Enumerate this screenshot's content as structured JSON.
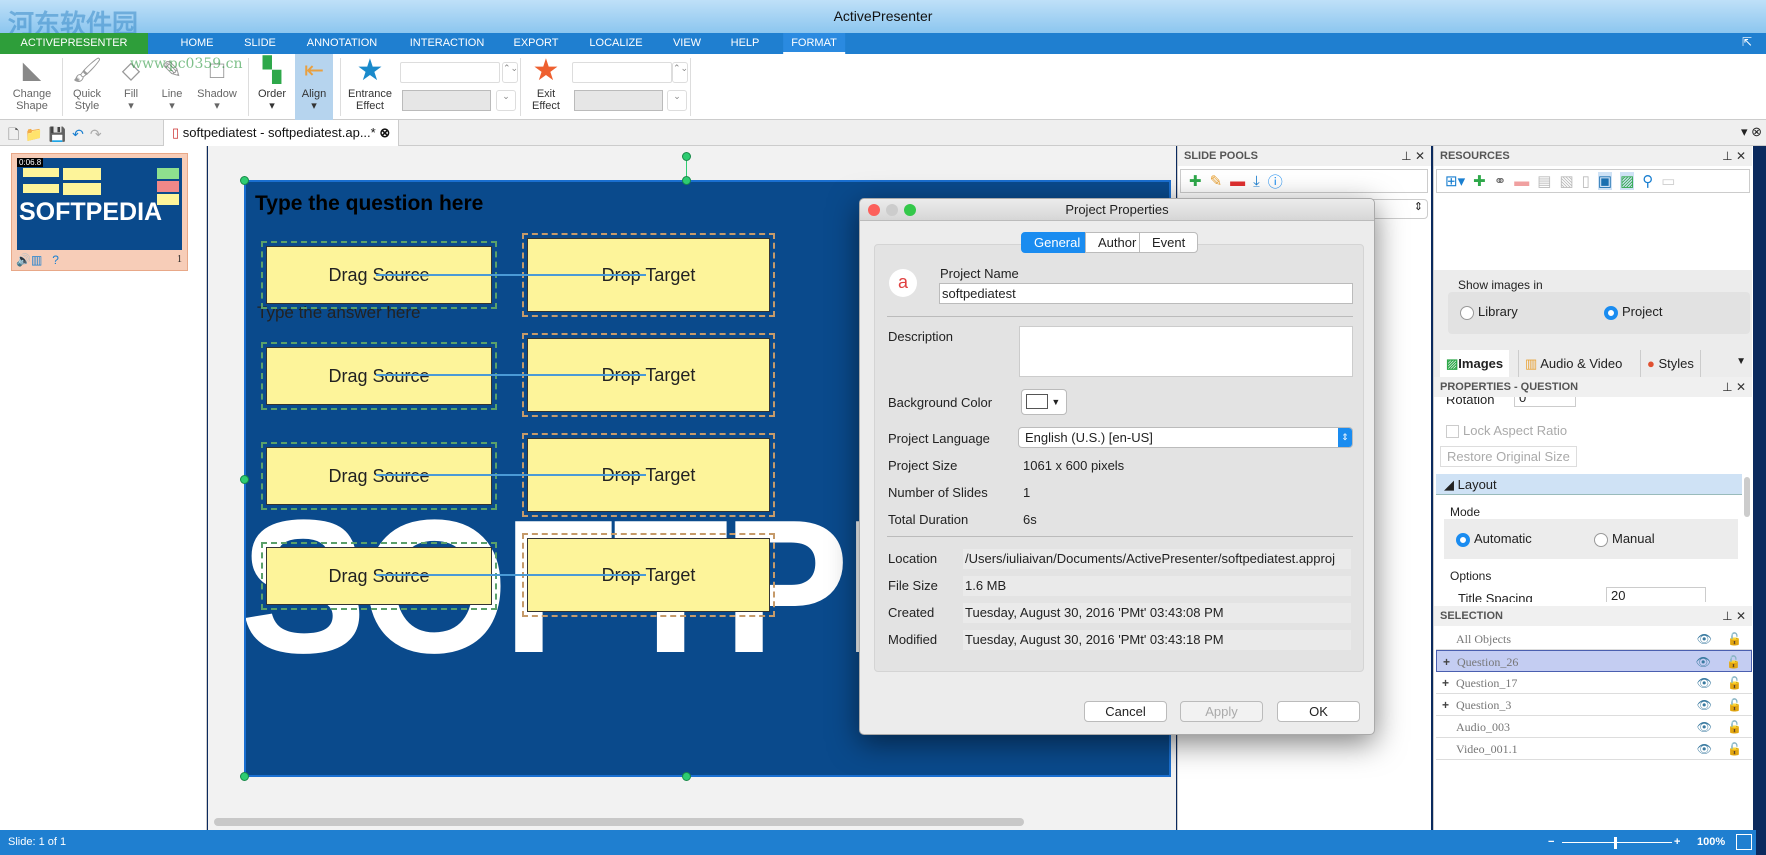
{
  "window": {
    "title": "ActivePresenter"
  },
  "watermark": {
    "text": "河东软件园",
    "url": "www.pc0359.cn"
  },
  "menu": [
    "ACTIVEPRESENTER",
    "HOME",
    "SLIDE",
    "ANNOTATION",
    "INTERACTION",
    "EXPORT",
    "LOCALIZE",
    "VIEW",
    "HELP",
    "FORMAT"
  ],
  "ribbon": {
    "change_shape": [
      "Change",
      "Shape"
    ],
    "quick_style": [
      "Quick",
      "Style"
    ],
    "fill": "Fill",
    "line": "Line",
    "shadow": "Shadow",
    "order": "Order",
    "align": "Align",
    "entrance": [
      "Entrance",
      "Effect"
    ],
    "exit": [
      "Exit",
      "Effect"
    ]
  },
  "doc_tab": {
    "label": "softpediatest - softpediatest.ap...*"
  },
  "thumbnail": {
    "time": "0:06.8",
    "number": "1",
    "logo": "SOFTPEDIA"
  },
  "slide": {
    "question": "Type the question here",
    "answer": "Type the answer here",
    "drag_sources": [
      "Drag Source",
      "Drag Source",
      "Drag Source",
      "Drag Source"
    ],
    "drop_targets": [
      "Drop Target",
      "Drop Target",
      "Drop Target",
      "Drop Target"
    ],
    "background_text": "SOFTPEDIA"
  },
  "slide_pools": {
    "title": "SLIDE POOLS"
  },
  "resources": {
    "title": "RESOURCES",
    "show_images_in": "Show images in",
    "library": "Library",
    "project": "Project",
    "tabs": [
      "Images",
      "Audio & Video",
      "Styles"
    ]
  },
  "properties": {
    "title": "PROPERTIES - QUESTION",
    "rotation": "Rotation",
    "rotation_value": "0",
    "lock_aspect": "Lock Aspect Ratio",
    "restore": "Restore Original Size",
    "layout": "Layout",
    "mode": "Mode",
    "automatic": "Automatic",
    "manual": "Manual",
    "options": "Options",
    "title_spacing": "Title Spacing",
    "title_spacing_value": "20"
  },
  "selection": {
    "title": "SELECTION",
    "items": [
      "All Objects",
      "Question_26",
      "Question_17",
      "Question_3",
      "Audio_003",
      "Video_001.1"
    ]
  },
  "status": {
    "slide": "Slide: 1 of 1",
    "zoom": "100%"
  },
  "dialog": {
    "title": "Project Properties",
    "tabs": [
      "General",
      "Author",
      "Event"
    ],
    "project_name_label": "Project Name",
    "project_name": "softpediatest",
    "description_label": "Description",
    "bg_color_label": "Background Color",
    "language_label": "Project Language",
    "language": "English (U.S.) [en-US]",
    "size_label": "Project Size",
    "size": "1061 x 600 pixels",
    "slides_label": "Number of Slides",
    "slides": "1",
    "duration_label": "Total Duration",
    "duration": "6s",
    "location_label": "Location",
    "location": "/Users/iuliaivan/Documents/ActivePresenter/softpediatest.approj",
    "filesize_label": "File Size",
    "filesize": "1.6 MB",
    "created_label": "Created",
    "created": "Tuesday, August 30, 2016 'PMt' 03:43:08 PM",
    "modified_label": "Modified",
    "modified": "Tuesday, August 30, 2016 'PMt' 03:43:18 PM",
    "cancel": "Cancel",
    "apply": "Apply",
    "ok": "OK"
  },
  "colors": {
    "accent": "#1f7fd0",
    "note": "#fdf49a",
    "slide_bg": "#0a4a8c"
  }
}
